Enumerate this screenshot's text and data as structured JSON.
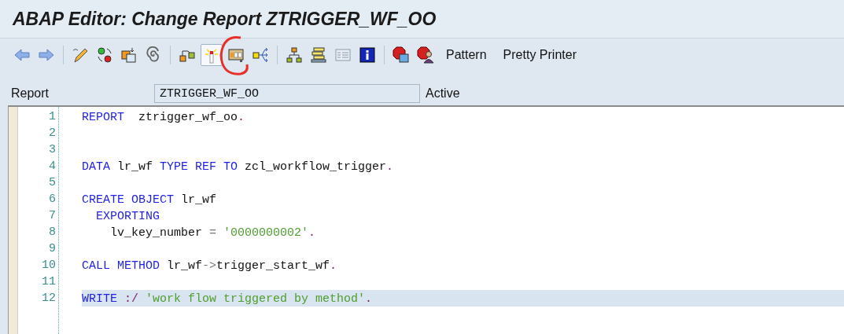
{
  "window": {
    "title": "ABAP Editor: Change Report ZTRIGGER_WF_OO"
  },
  "toolbar": [
    {
      "kind": "back",
      "pressed": false
    },
    {
      "kind": "forward",
      "pressed": false
    },
    {
      "kind": "separator"
    },
    {
      "kind": "pencil",
      "pressed": false
    },
    {
      "kind": "dots",
      "pressed": false
    },
    {
      "kind": "copy",
      "pressed": false
    },
    {
      "kind": "spiral",
      "pressed": false
    },
    {
      "kind": "separator"
    },
    {
      "kind": "link",
      "pressed": false
    },
    {
      "kind": "wand",
      "pressed": true
    },
    {
      "kind": "table",
      "pressed": false,
      "annotated": true
    },
    {
      "kind": "arrows",
      "pressed": false
    },
    {
      "kind": "separator"
    },
    {
      "kind": "tree",
      "pressed": false
    },
    {
      "kind": "stack",
      "pressed": false
    },
    {
      "kind": "panel",
      "pressed": false
    },
    {
      "kind": "info",
      "pressed": false
    },
    {
      "kind": "separator"
    },
    {
      "kind": "stopwin",
      "pressed": false
    },
    {
      "kind": "stopuser",
      "pressed": false
    }
  ],
  "toolbar_buttons": [
    "Pattern",
    "Pretty Printer"
  ],
  "report": {
    "label": "Report",
    "value": "ZTRIGGER_WF_OO",
    "status": "Active"
  },
  "editor": {
    "lines": [
      {
        "number": "1",
        "highlighted": false,
        "tokens": [
          {
            "kind": "keyword",
            "text": "REPORT  "
          },
          {
            "kind": "ident",
            "text": "ztrigger_wf_oo"
          },
          {
            "kind": "punct",
            "text": "."
          }
        ]
      },
      {
        "number": "2",
        "highlighted": false
      },
      {
        "number": "3",
        "highlighted": false
      },
      {
        "number": "4",
        "highlighted": false,
        "tokens": [
          {
            "kind": "keyword",
            "text": "DATA "
          },
          {
            "kind": "ident",
            "text": "lr_wf "
          },
          {
            "kind": "keyword",
            "text": "TYPE REF TO "
          },
          {
            "kind": "ident",
            "text": "zcl_workflow_trigger"
          },
          {
            "kind": "punct",
            "text": "."
          }
        ]
      },
      {
        "number": "5",
        "highlighted": false
      },
      {
        "number": "6",
        "highlighted": false,
        "tokens": [
          {
            "kind": "keyword",
            "text": "CREATE OBJECT "
          },
          {
            "kind": "ident",
            "text": "lr_wf"
          }
        ]
      },
      {
        "number": "7",
        "highlighted": false,
        "tokens": [
          {
            "kind": "keyword",
            "text": "  EXPORTING"
          }
        ]
      },
      {
        "number": "8",
        "highlighted": false,
        "tokens": [
          {
            "kind": "ident",
            "text": "    lv_key_number "
          },
          {
            "kind": "operator",
            "text": "= "
          },
          {
            "kind": "string",
            "text": "'0000000002'"
          },
          {
            "kind": "punct",
            "text": "."
          }
        ]
      },
      {
        "number": "9",
        "highlighted": false
      },
      {
        "number": "10",
        "highlighted": false,
        "tokens": [
          {
            "kind": "keyword",
            "text": "CALL METHOD "
          },
          {
            "kind": "ident",
            "text": "lr_wf"
          },
          {
            "kind": "operator",
            "text": "->"
          },
          {
            "kind": "ident",
            "text": "trigger_start_wf"
          },
          {
            "kind": "punct",
            "text": "."
          }
        ]
      },
      {
        "number": "11",
        "highlighted": false
      },
      {
        "number": "12",
        "highlighted": true,
        "tokens": [
          {
            "kind": "keyword",
            "text": "WRITE "
          },
          {
            "kind": "punct",
            "text": ":/ "
          },
          {
            "kind": "string",
            "text": "'work flow triggered by method'"
          },
          {
            "kind": "punct",
            "text": "."
          }
        ]
      }
    ]
  }
}
